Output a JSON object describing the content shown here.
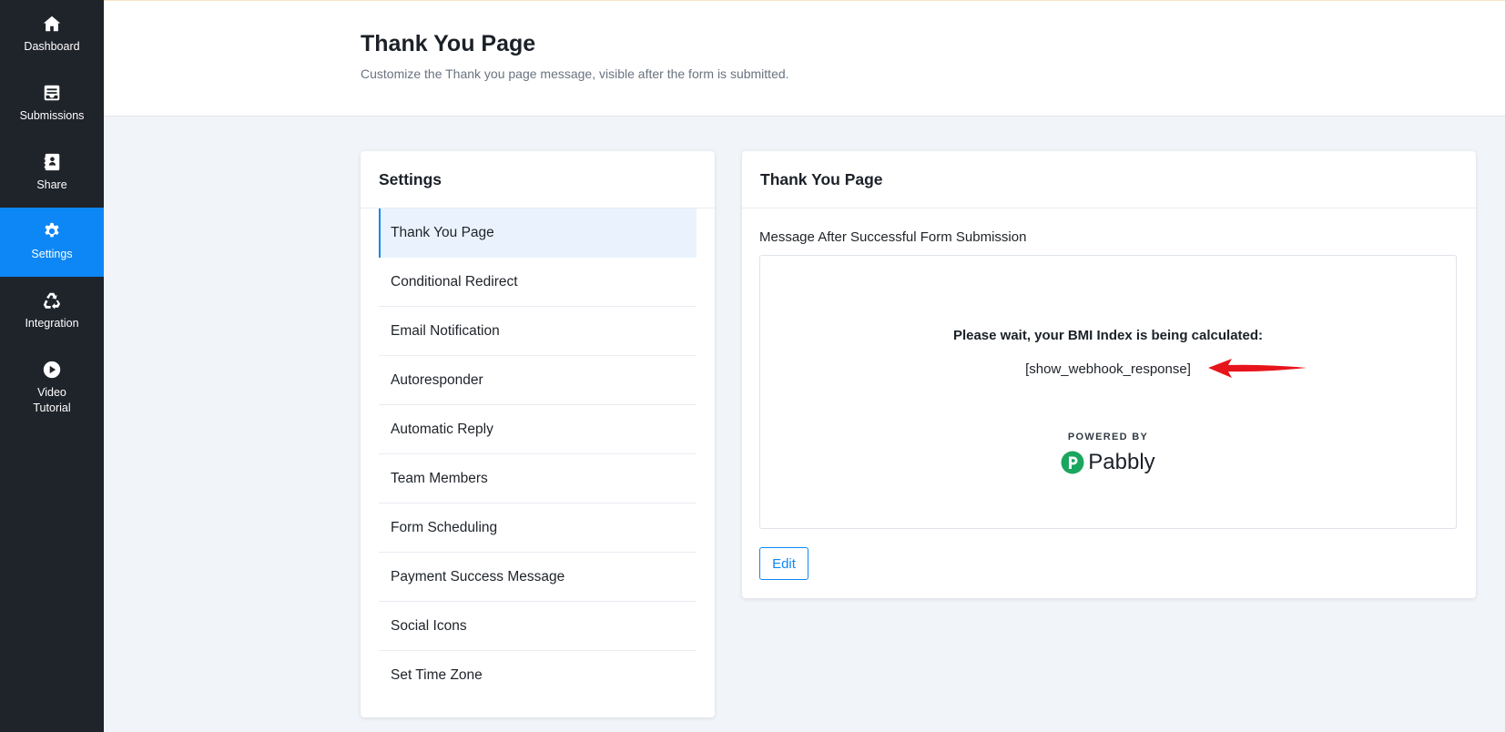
{
  "sidebar": {
    "items": [
      {
        "label": "Dashboard",
        "icon": "home-icon"
      },
      {
        "label": "Submissions",
        "icon": "inbox-icon"
      },
      {
        "label": "Share",
        "icon": "contact-book-icon"
      },
      {
        "label": "Settings",
        "icon": "gear-icon",
        "active": true
      },
      {
        "label": "Integration",
        "icon": "recycle-icon"
      },
      {
        "label": "Video Tutorial",
        "icon": "play-circle-icon"
      }
    ]
  },
  "header": {
    "title": "Thank You Page",
    "subtitle": "Customize the Thank you page message, visible after the form is submitted."
  },
  "settings_panel": {
    "title": "Settings",
    "items": [
      {
        "label": "Thank You Page",
        "active": true
      },
      {
        "label": "Conditional Redirect"
      },
      {
        "label": "Email Notification"
      },
      {
        "label": "Autoresponder"
      },
      {
        "label": "Automatic Reply"
      },
      {
        "label": "Team Members"
      },
      {
        "label": "Form Scheduling"
      },
      {
        "label": "Payment Success Message"
      },
      {
        "label": "Social Icons"
      },
      {
        "label": "Set Time Zone"
      }
    ]
  },
  "main_panel": {
    "title": "Thank You Page",
    "field_label": "Message After Successful Form Submission",
    "preview": {
      "message": "Please wait, your BMI Index is being calculated:",
      "shortcode": "[show_webhook_response]",
      "powered_by": "POWERED BY",
      "brand": "Pabbly"
    },
    "edit_label": "Edit"
  },
  "colors": {
    "sidebar_bg": "#1f232a",
    "accent": "#0d87f5",
    "brand_green": "#1aa65e",
    "arrow_red": "#e8141b"
  }
}
